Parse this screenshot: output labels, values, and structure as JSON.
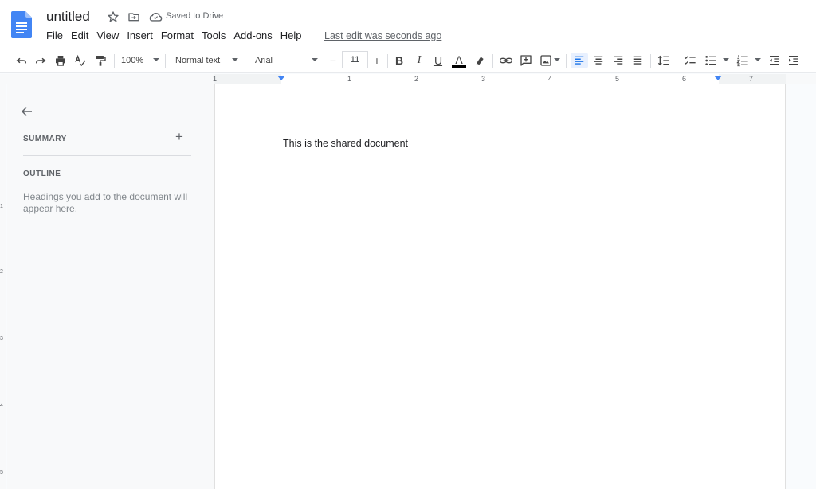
{
  "header": {
    "title": "untitled",
    "saved_status": "Saved to Drive",
    "last_edit": "Last edit was seconds ago",
    "icons": [
      "docs-logo-icon",
      "star-icon",
      "move-to-folder-icon",
      "cloud-saved-icon"
    ]
  },
  "menu": {
    "items": [
      "File",
      "Edit",
      "View",
      "Insert",
      "Format",
      "Tools",
      "Add-ons",
      "Help"
    ]
  },
  "toolbar": {
    "zoom": "100%",
    "style": "Normal text",
    "font": "Arial",
    "font_size": "11",
    "decrease_label": "−",
    "increase_label": "+",
    "bold_label": "B",
    "italic_label": "I",
    "underline_label": "U",
    "text_color_label": "A",
    "active_alignment": "left"
  },
  "ruler": {
    "numbers": [
      "1",
      "1",
      "2",
      "3",
      "4",
      "5",
      "6",
      "7"
    ]
  },
  "vertical_ruler": {
    "numbers": [
      "1",
      "2",
      "3",
      "4",
      "5"
    ]
  },
  "outline_panel": {
    "summary_label": "SUMMARY",
    "add_label": "+",
    "outline_label": "OUTLINE",
    "hint": "Headings you add to the document will appear here."
  },
  "document": {
    "body_text": "This is the shared document"
  },
  "colors": {
    "accent": "#4285f4",
    "doc_icon": "#4285f4",
    "active_bg": "#e8f0fe"
  }
}
